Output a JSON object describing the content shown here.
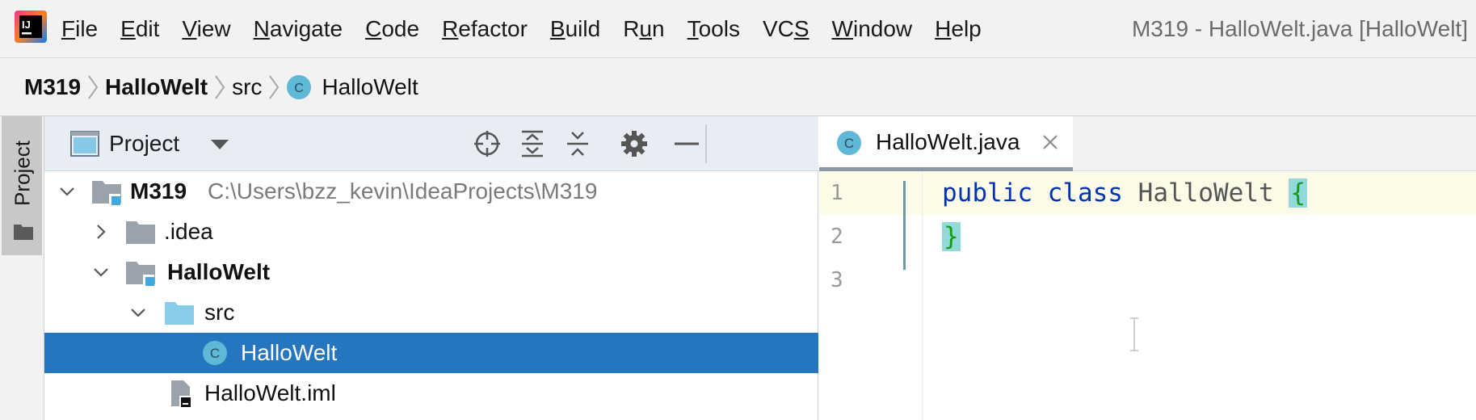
{
  "menubar": {
    "items": [
      {
        "label": "File",
        "mnemonic_index": 0
      },
      {
        "label": "Edit",
        "mnemonic_index": 0
      },
      {
        "label": "View",
        "mnemonic_index": 0
      },
      {
        "label": "Navigate",
        "mnemonic_index": 0
      },
      {
        "label": "Code",
        "mnemonic_index": 0
      },
      {
        "label": "Refactor",
        "mnemonic_index": 0
      },
      {
        "label": "Build",
        "mnemonic_index": 0
      },
      {
        "label": "Run",
        "mnemonic_index": 1
      },
      {
        "label": "Tools",
        "mnemonic_index": 0
      },
      {
        "label": "VCS",
        "mnemonic_index": 2
      },
      {
        "label": "Window",
        "mnemonic_index": 0
      },
      {
        "label": "Help",
        "mnemonic_index": 0
      }
    ],
    "window_title": "M319 - HalloWelt.java [HalloWelt]"
  },
  "breadcrumb": {
    "items": [
      {
        "label": "M319"
      },
      {
        "label": "HalloWelt"
      },
      {
        "label": "src"
      },
      {
        "label": "HalloWelt",
        "icon": "java-class-icon"
      }
    ]
  },
  "left_stripe": {
    "tab_label": "Project"
  },
  "project_panel": {
    "title": "Project",
    "tree": [
      {
        "label": "M319",
        "path": "C:\\Users\\bzz_kevin\\IdeaProjects\\M319",
        "expanded": true,
        "icon": "module-folder-icon",
        "bold": true
      },
      {
        "label": ".idea",
        "expanded": false,
        "icon": "folder-icon"
      },
      {
        "label": "HalloWelt",
        "expanded": true,
        "icon": "module-folder-icon",
        "bold": true
      },
      {
        "label": "src",
        "expanded": true,
        "icon": "source-folder-icon"
      },
      {
        "label": "HalloWelt",
        "icon": "java-class-icon",
        "selected": true
      },
      {
        "label": "HalloWelt.iml",
        "icon": "iml-file-icon"
      }
    ]
  },
  "editor": {
    "tab_label": "HalloWelt.java",
    "line_numbers": [
      "1",
      "2",
      "3"
    ],
    "code": {
      "line1_keyword1": "public",
      "line1_keyword2": "class",
      "line1_classname": "HalloWelt",
      "line1_brace": "{",
      "line2_brace": "}"
    }
  },
  "colors": {
    "selection": "#2675bf",
    "keyword": "#0033b3",
    "brace_match_bg": "#93d9d9",
    "class_icon": "#5fb8d6"
  }
}
